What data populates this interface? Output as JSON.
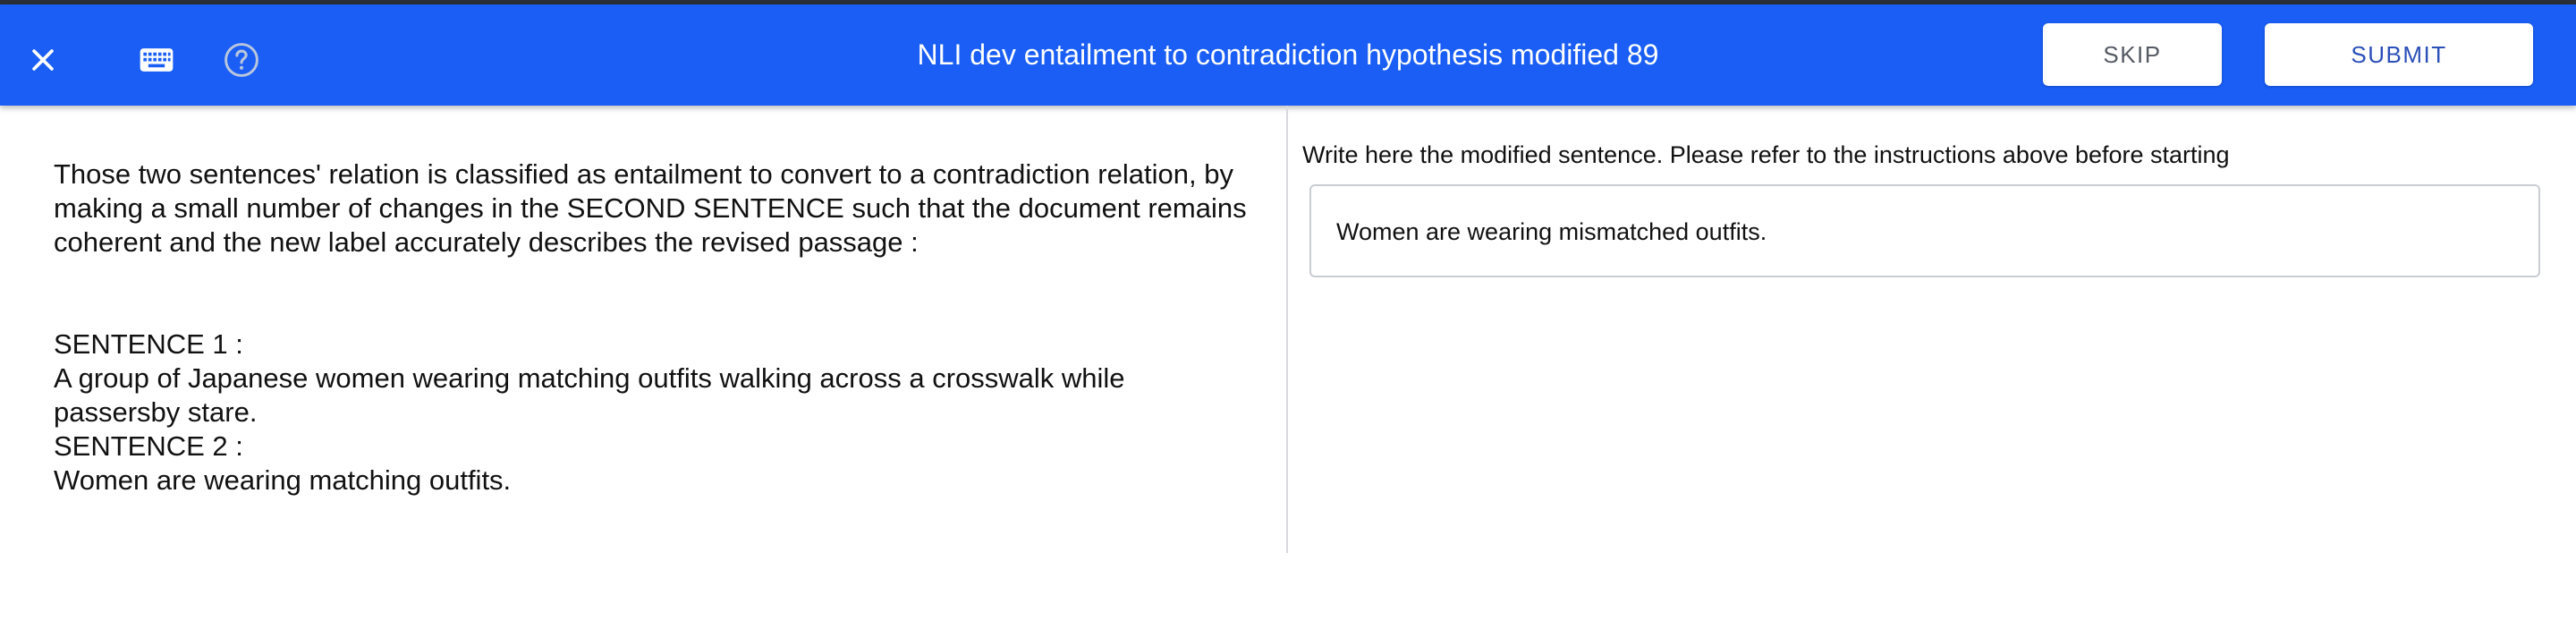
{
  "toolbar": {
    "title": "NLI dev entailment to contradiction hypothesis modified 89",
    "skip_label": "SKIP",
    "submit_label": "SUBMIT",
    "icons": [
      "close-icon",
      "keyboard-icon",
      "help-icon"
    ]
  },
  "instructions": {
    "text": "Those two sentences' relation is classified as entailment to convert to a contradiction relation, by making a small number of changes in the SECOND SENTENCE such that the document remains coherent and the new label accurately describes the revised passage :"
  },
  "sentences": {
    "s1_label": "SENTENCE 1 :",
    "s1_text": "A group of Japanese women wearing matching outfits walking across a crosswalk while passersby stare.",
    "s2_label": "SENTENCE 2 :",
    "s2_text": "Women are wearing matching outfits."
  },
  "response": {
    "label": "Write here the modified sentence. Please refer to the instructions above before starting",
    "value": "Women are wearing mismatched outfits."
  },
  "colors": {
    "toolbar": "#1a5ef5",
    "submit_text": "#2b4fb8"
  }
}
